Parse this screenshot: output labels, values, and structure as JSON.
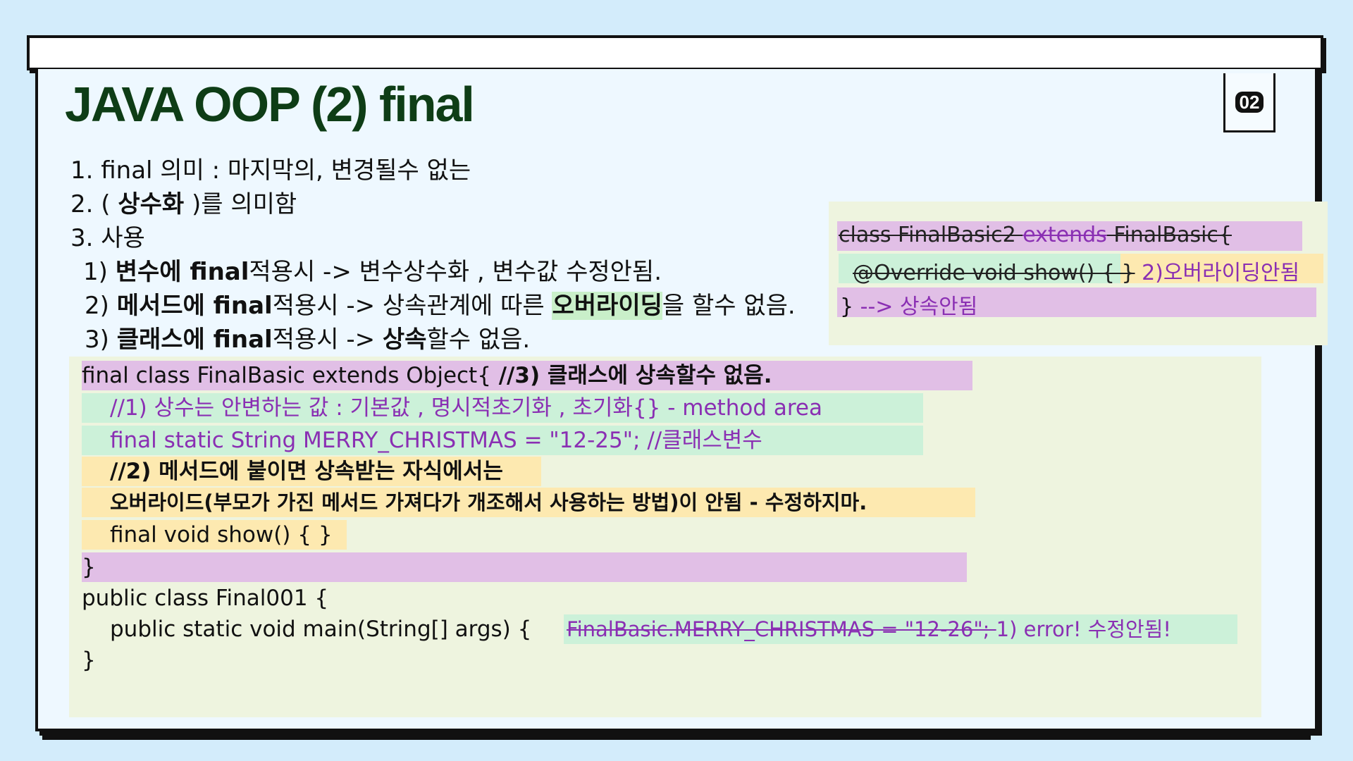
{
  "header": {
    "title": "JAVA OOP (2)   final",
    "page_number": "02"
  },
  "notes": {
    "line1": "1.  final  의미 :  마지막의, 변경될수 없는",
    "line2_pre": "2.  ( ",
    "line2_bold": "상수화",
    "line2_post": " )를 의미함",
    "line3": "3.  사용",
    "item1_pre": "1)     ",
    "item1_bold": "변수에 final",
    "item1_post": "적용시 ->  변수상수화 , 변수값 수정안됨.",
    "item2_pre": "2) ",
    "item2_bold": "메서드에 final",
    "item2_mid": "적용시 ->  상속관계에 따른 ",
    "item2_hl": "오버라이딩",
    "item2_post": "을 할수 없음.",
    "item3_pre": "3) ",
    "item3_bold": "클래스에 final",
    "item3_mid": "적용시 ->  ",
    "item3_bold2": "상속",
    "item3_post": "할수 없음."
  },
  "side_code": {
    "line1_a": "class FinalBasic2 ",
    "line1_b": "extends",
    "line1_c": " FinalBasic{",
    "line2_code": "@Override void show() { }",
    "line2_note": " 2)오버라이딩안됨",
    "line3_brace": "}",
    "line3_note": " --> 상속안됨"
  },
  "code": {
    "l1_code": "final class FinalBasic extends Object{",
    "l1_comment": "   //3) 클래스에 상속할수 없음.",
    "l2": "//1) 상수는 안변하는 값 : 기본값 , 명시적초기화 , 초기화{} - method area",
    "l3_code": "final  static  String MERRY_CHRISTMAS = \"12-25\"; ",
    "l3_comment": "//클래스변수",
    "l4": "//2) 메서드에 붙이면 상속받는 자식에서는",
    "l5": "오버라이드(부모가 가진 메서드 가져다가 개조해서 사용하는 방법)이 안됨 - 수정하지마.",
    "l6": "final void show() {  }",
    "l7": "}",
    "l8": "public class Final001 {",
    "l9_code": "public static void main(String[] args) {",
    "l9_strike": "FinalBasic.MERRY_CHRISTMAS = \"12-26\"; ",
    "l9_note": " 1)  error!  수정안됨!",
    "l10": "}"
  },
  "colors": {
    "title": "#0e3d16",
    "purple_band": "#e1bfe6",
    "mint_band": "#ccf1d9",
    "yellow_band": "#fde9b0",
    "purple_text": "#8a2fb3",
    "panel_bg": "#eef4df"
  }
}
